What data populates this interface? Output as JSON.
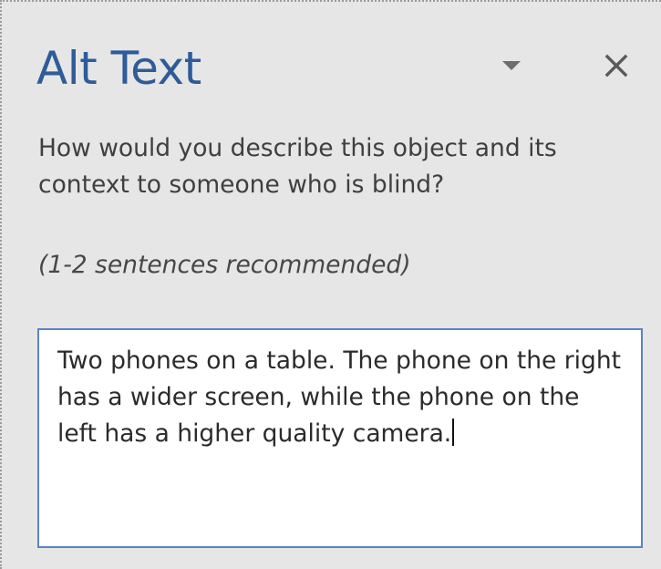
{
  "panel": {
    "title": "Alt Text",
    "question": "How would you describe this object and its context to someone who is blind?",
    "hint": "(1-2 sentences recommended)",
    "description_value": "Two phones on a table. The phone on the right has a wider screen, while the phone on the left has a higher quality camera.",
    "options_icon": "chevron-down-icon",
    "close_icon": "close-icon"
  },
  "colors": {
    "pane_background": "#e6e6e6",
    "title": "#2e5c99",
    "input_border": "#5b82c9",
    "body_text": "#3f3f3f"
  }
}
